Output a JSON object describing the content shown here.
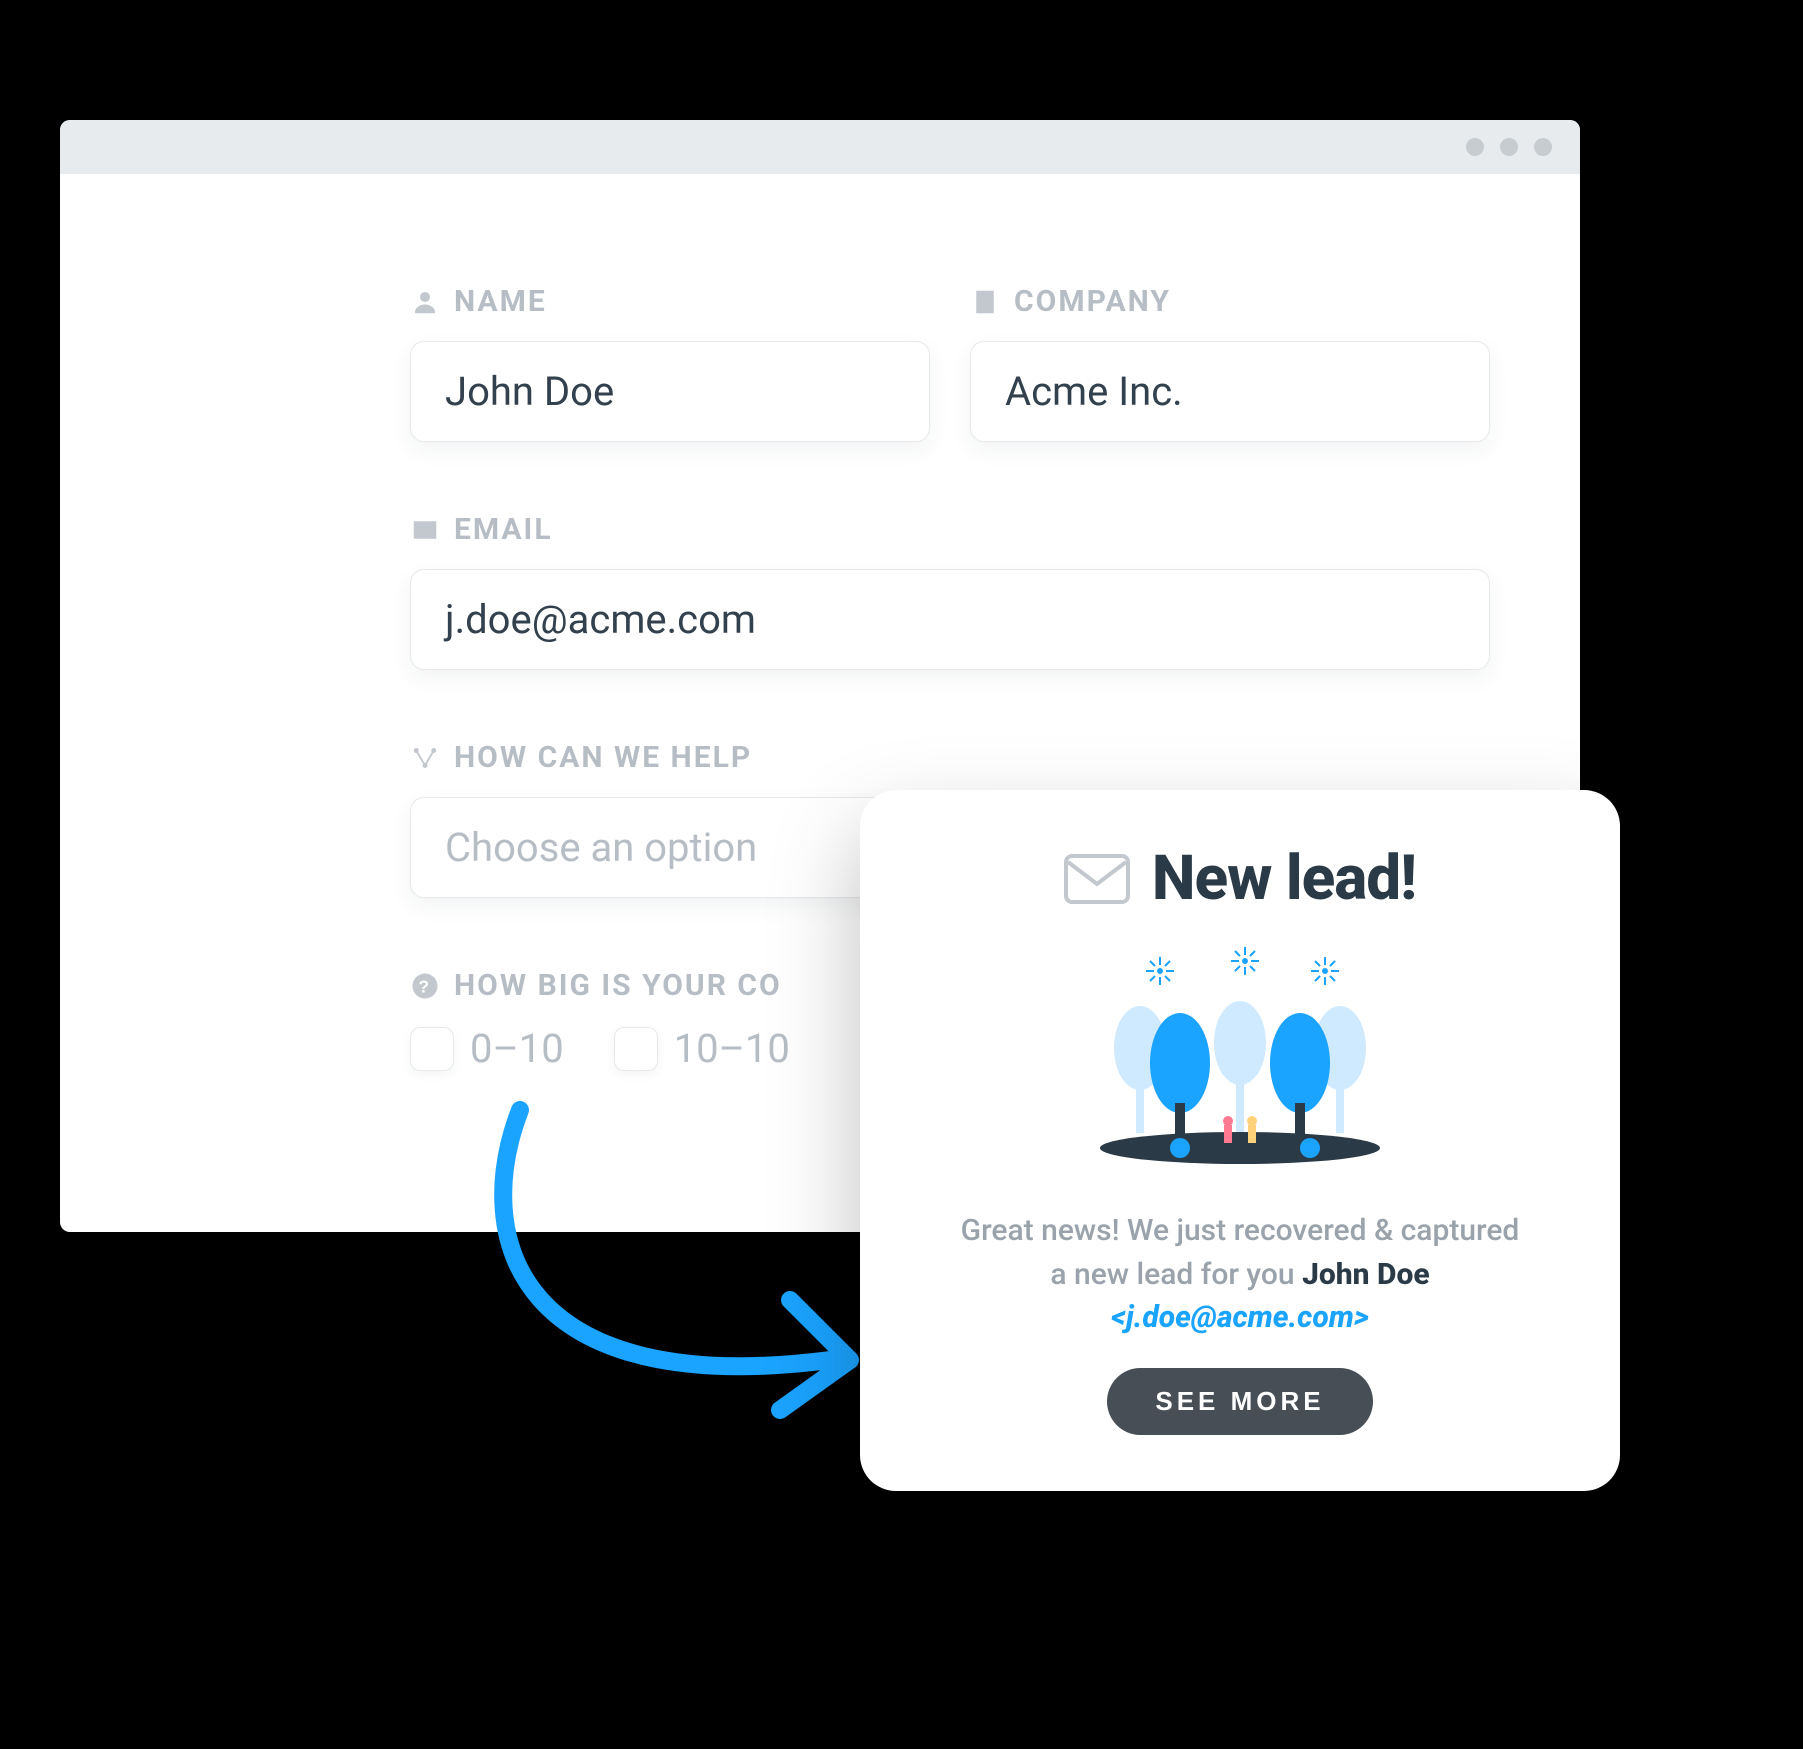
{
  "form": {
    "name": {
      "label": "NAME",
      "value": "John Doe"
    },
    "company": {
      "label": "COMPANY",
      "value": "Acme Inc."
    },
    "email": {
      "label": "EMAIL",
      "value": "j.doe@acme.com"
    },
    "help": {
      "label": "HOW CAN WE HELP",
      "placeholder": "Choose an option"
    },
    "size": {
      "label": "HOW BIG IS YOUR CO",
      "options": [
        "0–10",
        "10–10"
      ]
    }
  },
  "notification": {
    "title": "New lead!",
    "body_prefix": "Great news! We just recovered & captured a new lead for you ",
    "lead_name": "John Doe",
    "lead_email_display": "<j.doe@acme.com>",
    "button": "SEE MORE"
  }
}
